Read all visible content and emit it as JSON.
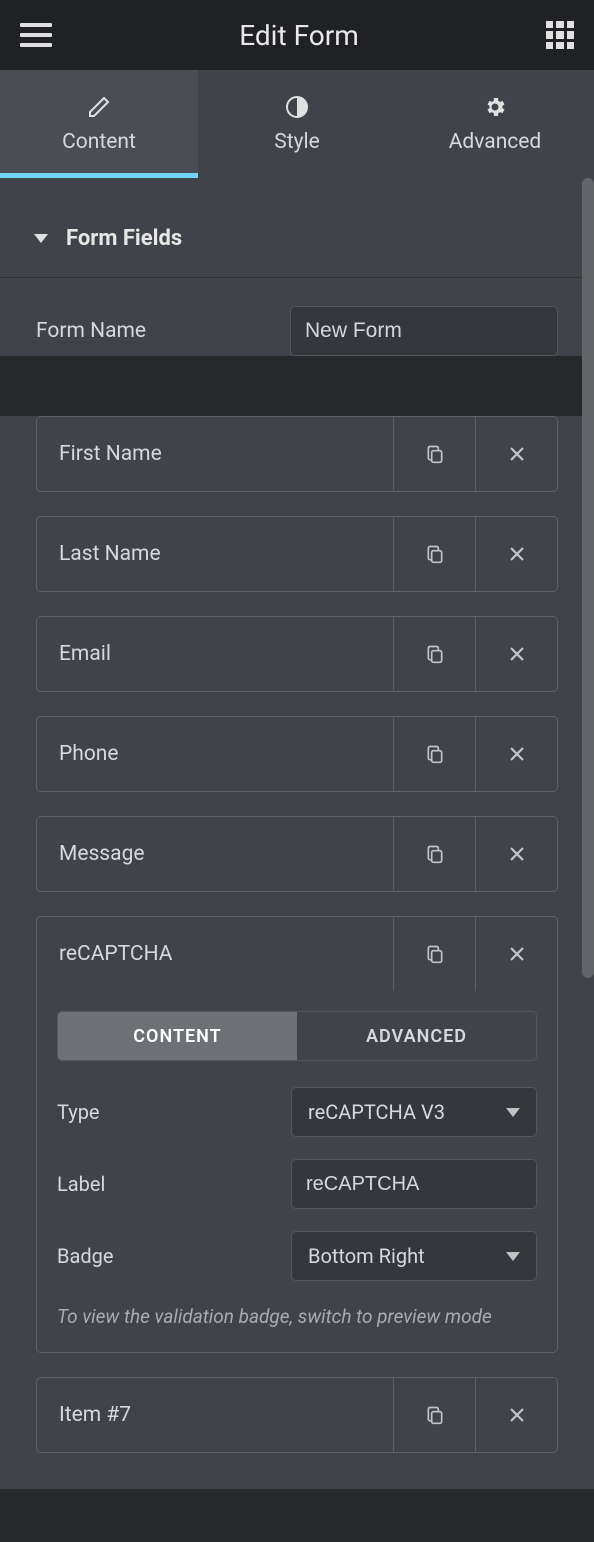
{
  "header": {
    "title": "Edit Form"
  },
  "tabs": [
    {
      "label": "Content",
      "active": true
    },
    {
      "label": "Style",
      "active": false
    },
    {
      "label": "Advanced",
      "active": false
    }
  ],
  "section": {
    "title": "Form Fields"
  },
  "form_name": {
    "label": "Form Name",
    "value": "New Form"
  },
  "fields": [
    {
      "label": "First Name"
    },
    {
      "label": "Last Name"
    },
    {
      "label": "Email"
    },
    {
      "label": "Phone"
    },
    {
      "label": "Message"
    },
    {
      "label": "reCAPTCHA",
      "expanded": true
    },
    {
      "label": "Item #7"
    }
  ],
  "expanded": {
    "sub_tabs": {
      "content": "CONTENT",
      "advanced": "ADVANCED"
    },
    "type": {
      "label": "Type",
      "value": "reCAPTCHA V3"
    },
    "label_field": {
      "label": "Label",
      "value": "reCAPTCHA"
    },
    "badge": {
      "label": "Badge",
      "value": "Bottom Right"
    },
    "hint": "To view the validation badge, switch to preview mode"
  }
}
